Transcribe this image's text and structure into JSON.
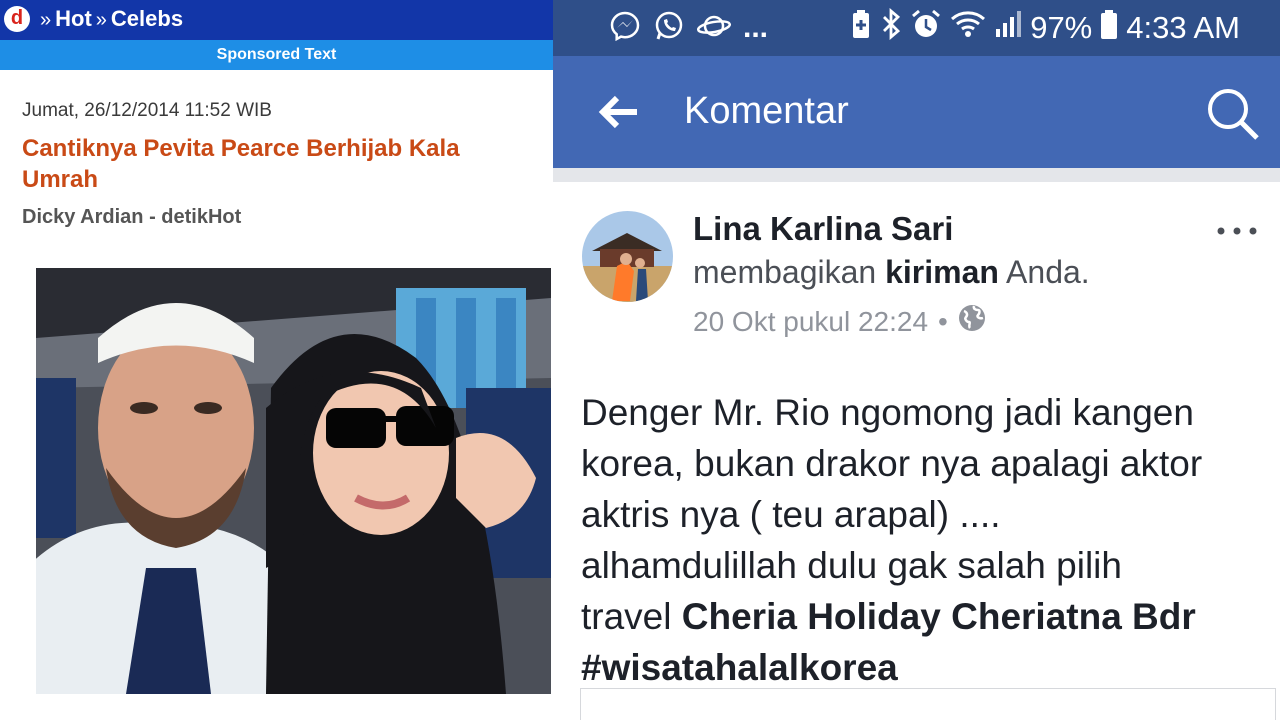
{
  "detik": {
    "logo_letter": "d",
    "crumbs": [
      "Hot",
      "Celebs"
    ],
    "crumb_sep": "»",
    "sponsored": "Sponsored Text",
    "date": "Jumat, 26/12/2014 11:52 WIB",
    "title": "Cantiknya Pevita Pearce Berhijab Kala Umrah",
    "author": "Dicky Ardian - detikHot"
  },
  "status_bar": {
    "more": "...",
    "battery": "97%",
    "time": "4:33 AM"
  },
  "appbar": {
    "title": "Komentar"
  },
  "post": {
    "author": "Lina Karlina Sari",
    "shared_prefix": "membagikan",
    "shared_bold": "kiriman",
    "shared_suffix": "Anda.",
    "timestamp": "20 Okt pukul 22:24",
    "dot": "•",
    "text_lines": [
      "Denger Mr. Rio ngomong jadi kangen",
      "korea, bukan drakor nya apalagi aktor",
      "aktris nya ( teu arapal) ....",
      "alhamdulillah dulu gak salah pilih"
    ],
    "text_travel": "travel",
    "text_travel_bold": "Cheria Holiday Cheriatna Bdr",
    "hashtag": "#wisatahalalkorea"
  },
  "colors": {
    "detik_blue": "#1236a8",
    "sponsor_blue": "#1e8ee6",
    "title_orange": "#c94a16",
    "fb_status": "#2f4f89",
    "fb_appbar": "#4268b4"
  }
}
